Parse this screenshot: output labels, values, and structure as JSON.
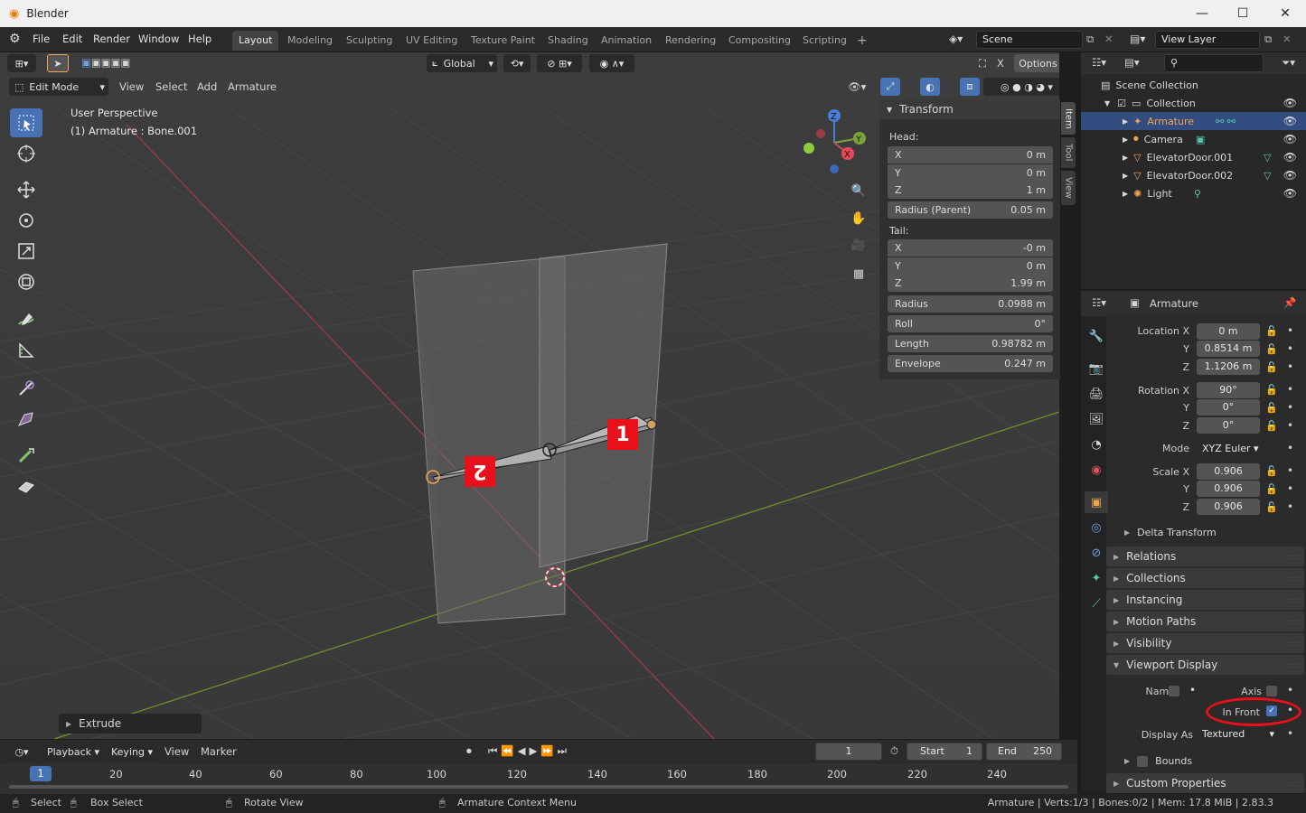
{
  "window": {
    "title": "Blender",
    "min": "—",
    "max": "☐",
    "close": "✕"
  },
  "menu": [
    "File",
    "Edit",
    "Render",
    "Window",
    "Help"
  ],
  "workspaces": [
    "Layout",
    "Modeling",
    "Sculpting",
    "UV Editing",
    "Texture Paint",
    "Shading",
    "Animation",
    "Rendering",
    "Compositing",
    "Scripting"
  ],
  "workspace_add": "+",
  "scene": {
    "label": "Scene",
    "view_layer": "View Layer"
  },
  "viewport_header": {
    "transform_orientation": "Global",
    "options": "Options",
    "mode": "Edit Mode",
    "menus": [
      "View",
      "Select",
      "Add",
      "Armature"
    ]
  },
  "viewport": {
    "info_line1": "User Perspective",
    "info_line2": "(1) Armature : Bone.001",
    "gizmo": {
      "x": "X",
      "y": "Y",
      "z": "Z"
    },
    "annotations": {
      "badge1": "1",
      "badge2": "2"
    },
    "last_op": "Extrude"
  },
  "npanel": {
    "title": "Transform",
    "head_label": "Head:",
    "head": [
      {
        "axis": "X",
        "val": "0 m"
      },
      {
        "axis": "Y",
        "val": "0 m"
      },
      {
        "axis": "Z",
        "val": "1 m"
      }
    ],
    "radius_parent": {
      "label": "Radius (Parent)",
      "val": "0.05 m"
    },
    "tail_label": "Tail:",
    "tail": [
      {
        "axis": "X",
        "val": "-0 m"
      },
      {
        "axis": "Y",
        "val": "0 m"
      },
      {
        "axis": "Z",
        "val": "1.99 m"
      }
    ],
    "radius": {
      "label": "Radius",
      "val": "0.0988 m"
    },
    "roll": {
      "label": "Roll",
      "val": "0°"
    },
    "length": {
      "label": "Length",
      "val": "0.98782 m"
    },
    "envelope": {
      "label": "Envelope",
      "val": "0.247 m"
    },
    "tabs": [
      "Item",
      "Tool",
      "View"
    ]
  },
  "outliner": {
    "root": "Scene Collection",
    "collection": "Collection",
    "items": [
      "Armature",
      "Camera",
      "ElevatorDoor.001",
      "ElevatorDoor.002",
      "Light"
    ]
  },
  "properties": {
    "object_name": "Armature",
    "location": {
      "label": "Location X",
      "x": "0 m",
      "y": "0.8514 m",
      "z": "1.1206 m"
    },
    "rotation": {
      "label": "Rotation X",
      "x": "90°",
      "y": "0°",
      "z": "0°"
    },
    "mode": {
      "label": "Mode",
      "val": "XYZ Euler"
    },
    "scale": {
      "label": "Scale X",
      "x": "0.906",
      "y": "0.906",
      "z": "0.906"
    },
    "axis_y": "Y",
    "axis_z": "Z",
    "delta": "Delta Transform",
    "sections": [
      "Relations",
      "Collections",
      "Instancing",
      "Motion Paths",
      "Visibility"
    ],
    "viewport_display": "Viewport Display",
    "vd": {
      "name": "Name",
      "axis": "Axis",
      "in_front": "In Front",
      "display_as": "Display As",
      "display_as_val": "Textured",
      "bounds": "Bounds"
    },
    "custom": "Custom Properties"
  },
  "timeline": {
    "menus": [
      "Playback",
      "Keying",
      "View",
      "Marker"
    ],
    "current_frame": "1",
    "start_label": "Start",
    "start": "1",
    "end_label": "End",
    "end": "250",
    "ruler": [
      "1",
      "20",
      "40",
      "60",
      "80",
      "100",
      "120",
      "140",
      "160",
      "180",
      "200",
      "220",
      "240"
    ]
  },
  "statusbar": {
    "select": "Select",
    "box_select": "Box Select",
    "rotate": "Rotate View",
    "context": "Armature Context Menu",
    "info": "Armature | Verts:1/3 | Bones:0/2 | Mem: 17.8 MiB | 2.83.3"
  },
  "colors": {
    "accent": "#4772b3",
    "selected_text": "#f0a552",
    "highlight_red": "#e8101a",
    "x_axis": "#c44a55",
    "y_axis": "#7ca33a"
  }
}
